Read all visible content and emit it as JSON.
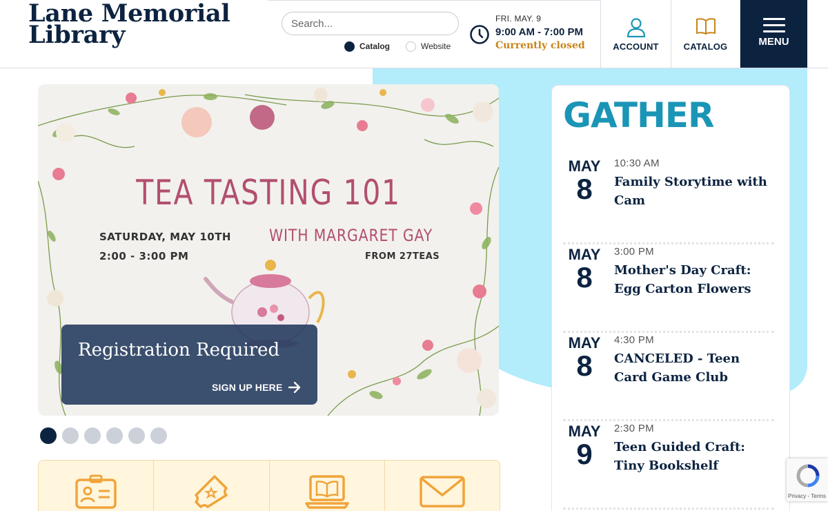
{
  "site": {
    "name_line1": "Lane Memorial",
    "name_line2": "Library"
  },
  "search": {
    "placeholder": "Search...",
    "options": [
      "Catalog",
      "Website"
    ],
    "selected": "Catalog"
  },
  "hours": {
    "day": "FRI. MAY. 9",
    "time": "9:00 AM - 7:00 PM",
    "status": "Currently closed"
  },
  "nav": {
    "account_label": "ACCOUNT",
    "catalog_label": "CATALOG",
    "menu_label": "MENU"
  },
  "slide": {
    "title": "TEA TASTING 101",
    "date": "SATURDAY, MAY 10TH",
    "time": "2:00 - 3:00 PM",
    "with": "WITH MARGARET GAY",
    "from": "FROM 27TEAS",
    "registration_title": "Registration Required",
    "registration_link": "SIGN UP HERE",
    "total_slides": 6,
    "active_slide": 1
  },
  "quick_links": [
    "id-card-icon",
    "ticket-icon",
    "laptop-book-icon",
    "envelope-icon"
  ],
  "gather": {
    "title": "GATHER",
    "events": [
      {
        "month": "MAY",
        "day": "8",
        "time": "10:30 AM",
        "title": "Family Storytime with Cam"
      },
      {
        "month": "MAY",
        "day": "8",
        "time": "3:00 PM",
        "title": "Mother's Day Craft: Egg Carton Flowers"
      },
      {
        "month": "MAY",
        "day": "8",
        "time": "4:30 PM",
        "title": "CANCELED - Teen Card Game Club"
      },
      {
        "month": "MAY",
        "day": "9",
        "time": "2:30 PM",
        "title": "Teen Guided Craft: Tiny Bookshelf"
      }
    ]
  },
  "recaptcha": {
    "text": "Privacy - Terms"
  },
  "colors": {
    "navy": "#0c2340",
    "teal": "#1b95b6",
    "gold": "#c8841a",
    "sky": "#b3ecfb",
    "orange_icon": "#f0a43a"
  }
}
